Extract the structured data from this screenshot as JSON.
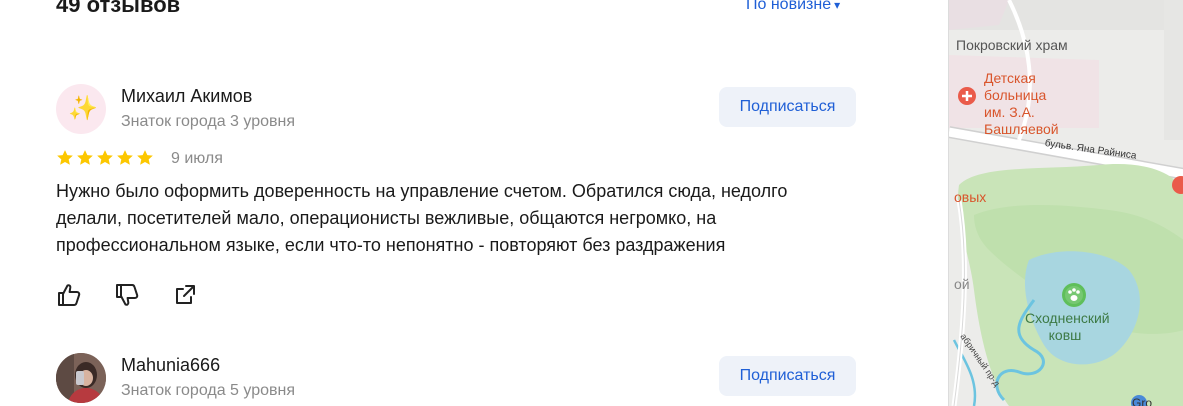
{
  "header": {
    "reviews_count": "49 отзывов",
    "sort_label": "По новизне"
  },
  "reviews": [
    {
      "author": "Михаил Акимов",
      "level": "Знаток города 3 уровня",
      "subscribe_label": "Подписаться",
      "rating": 5,
      "date": "9 июля",
      "text": "Нужно было оформить доверенность на управление счетом. Обратился сюда, недолго делали, посетителей мало, операционисты вежливые, общаются негромко, на профессиональном языке, если что-то непонятно - повторяют без раздражения"
    },
    {
      "author": "Mahunia666",
      "level": "Знаток города 5 уровня",
      "subscribe_label": "Подписаться"
    }
  ],
  "map": {
    "church": "Покровский храм",
    "hospital": "Детская больница им. З.А. Башляевой",
    "street": "бульв. Яна Райниса",
    "park": "Сходненский ковш",
    "partial_label_1": "овых",
    "partial_label_2": "ой",
    "partial_label_3": "абричный пр-д",
    "partial_label_4": "Gro"
  },
  "colors": {
    "accent": "#1f5fd6",
    "star": "#fcc700",
    "subscribe_bg": "#eef2f9",
    "muted_text": "#8a8a8a"
  }
}
